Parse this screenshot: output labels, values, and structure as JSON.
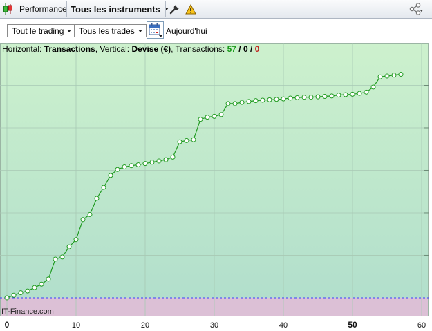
{
  "toolbar": {
    "tab_label": "Performance",
    "instruments_label": "Tous les instruments",
    "icons": [
      "candlestick-icon",
      "wrench-icon",
      "warning-icon",
      "share-icon"
    ]
  },
  "subbar": {
    "trading_dropdown": "Tout le trading",
    "trades_dropdown": "Tous les trades",
    "today_label": "Aujourd'hui"
  },
  "chart_info": {
    "horizontal_label": "Horizontal:",
    "horizontal_value": "Transactions",
    "vertical_label": "Vertical:",
    "vertical_value": "Devise (€)",
    "transactions_label": "Transactions:",
    "total": "57",
    "slash1": "/",
    "neutral": "0",
    "slash2": "/",
    "losing": "0",
    "total_color": "#1a9a1a",
    "losing_color": "#c0201a"
  },
  "watermark": "IT-Finance.com",
  "colors": {
    "positive_bg_top": "#cdf1cd",
    "positive_bg_bottom": "#b2dfcc",
    "negative_bg": "#dcc0d6",
    "line": "#1f9a1f",
    "baseline": "#3c3cff"
  },
  "chart_data": {
    "type": "line",
    "xlabel": "",
    "ylabel": "",
    "xlim": [
      -1,
      61
    ],
    "ylim": [
      -0.44,
      6
    ],
    "grid": true,
    "x_ticks": [
      0,
      10,
      20,
      30,
      40,
      50,
      60
    ],
    "x_ticks_bold": [
      0,
      50
    ],
    "baseline_y": 0,
    "series": [
      {
        "x": [
          0,
          1,
          2,
          3,
          4,
          5,
          6,
          7,
          8,
          9,
          10,
          11,
          12,
          13,
          14,
          15,
          16,
          17,
          18,
          19,
          20,
          21,
          22,
          23,
          24,
          25,
          26,
          27,
          28,
          29,
          30,
          31,
          32,
          33,
          34,
          35,
          36,
          37,
          38,
          39,
          40,
          41,
          42,
          43,
          44,
          45,
          46,
          47,
          48,
          49,
          50,
          51,
          52,
          53,
          54,
          55,
          56,
          57
        ],
        "y": [
          0,
          0.06,
          0.12,
          0.16,
          0.24,
          0.32,
          0.44,
          0.91,
          0.96,
          1.2,
          1.37,
          1.84,
          1.96,
          2.34,
          2.6,
          2.88,
          3.02,
          3.08,
          3.11,
          3.13,
          3.16,
          3.19,
          3.22,
          3.25,
          3.31,
          3.67,
          3.7,
          3.72,
          4.2,
          4.25,
          4.27,
          4.31,
          4.57,
          4.57,
          4.6,
          4.62,
          4.64,
          4.65,
          4.66,
          4.67,
          4.68,
          4.7,
          4.71,
          4.72,
          4.72,
          4.73,
          4.74,
          4.75,
          4.77,
          4.78,
          4.79,
          4.81,
          4.84,
          4.96,
          5.2,
          5.22,
          5.24,
          5.26
        ]
      }
    ]
  }
}
